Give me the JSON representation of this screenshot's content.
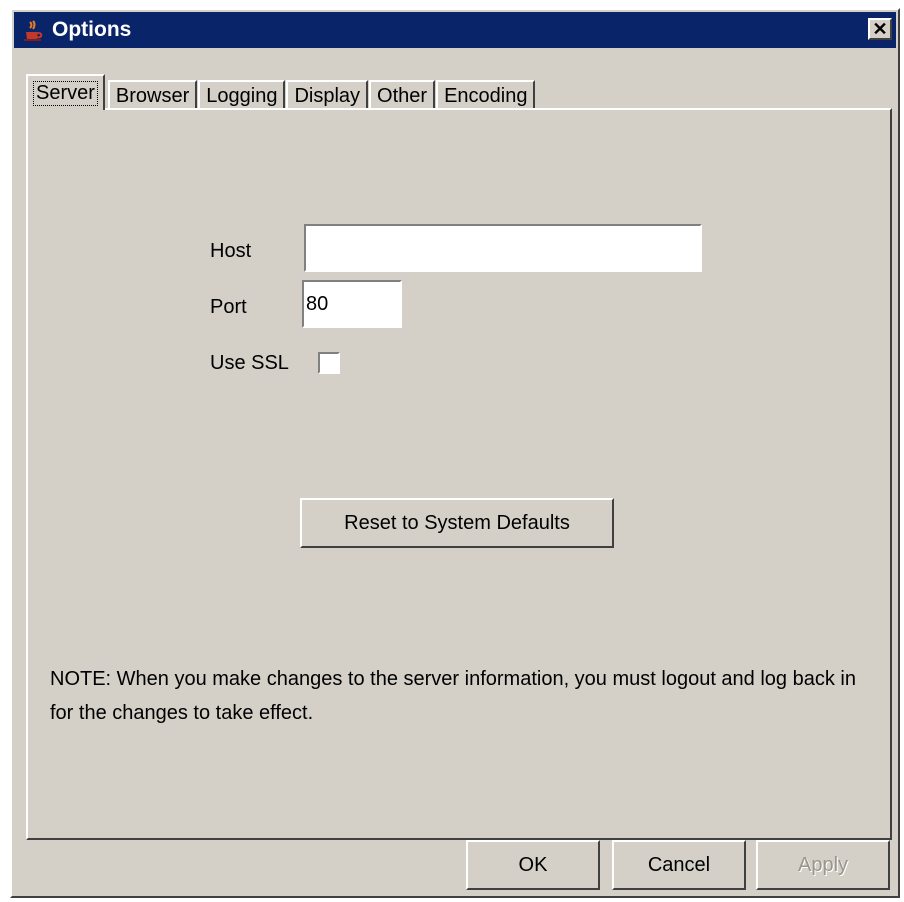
{
  "window": {
    "title": "Options",
    "close_symbol": "✕",
    "icon": "java-cup-icon"
  },
  "tabs": [
    {
      "label": "Server",
      "active": true
    },
    {
      "label": "Browser",
      "active": false
    },
    {
      "label": "Logging",
      "active": false
    },
    {
      "label": "Display",
      "active": false
    },
    {
      "label": "Other",
      "active": false
    },
    {
      "label": "Encoding",
      "active": false
    }
  ],
  "server": {
    "host_label": "Host",
    "host_value": "",
    "port_label": "Port",
    "port_value": "80",
    "ssl_label": "Use SSL",
    "ssl_checked": false,
    "reset_label": "Reset to System Defaults",
    "note": "NOTE: When you make changes to the server information, you must logout and log back in for the changes to take effect."
  },
  "footer": {
    "ok_label": "OK",
    "cancel_label": "Cancel",
    "apply_label": "Apply"
  }
}
